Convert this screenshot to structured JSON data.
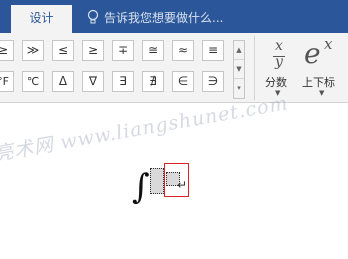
{
  "tabs": {
    "active_label": "设计"
  },
  "tell_me": {
    "placeholder": "告诉我您想要做什么..."
  },
  "symbols": {
    "row1": [
      "≥",
      "≫",
      "≤",
      "≥",
      "∓",
      "≅",
      "≈",
      "≡"
    ],
    "row2": [
      "°F",
      "℃",
      "Δ",
      "∇",
      "∃",
      "∄",
      "∈",
      "∋"
    ]
  },
  "gallery_scroll": {
    "up": "▲",
    "down": "▼",
    "more": "▾"
  },
  "fraction_button": {
    "numerator": "x",
    "denominator": "y",
    "label": "分数",
    "caret": "▼"
  },
  "script_button": {
    "base": "e",
    "superscript": "x",
    "label": "上下标",
    "caret": "▼"
  },
  "document": {
    "watermark": "亮术网 www.liangshunet.com",
    "integral_symbol": "∫",
    "paragraph_mark": "↵"
  }
}
